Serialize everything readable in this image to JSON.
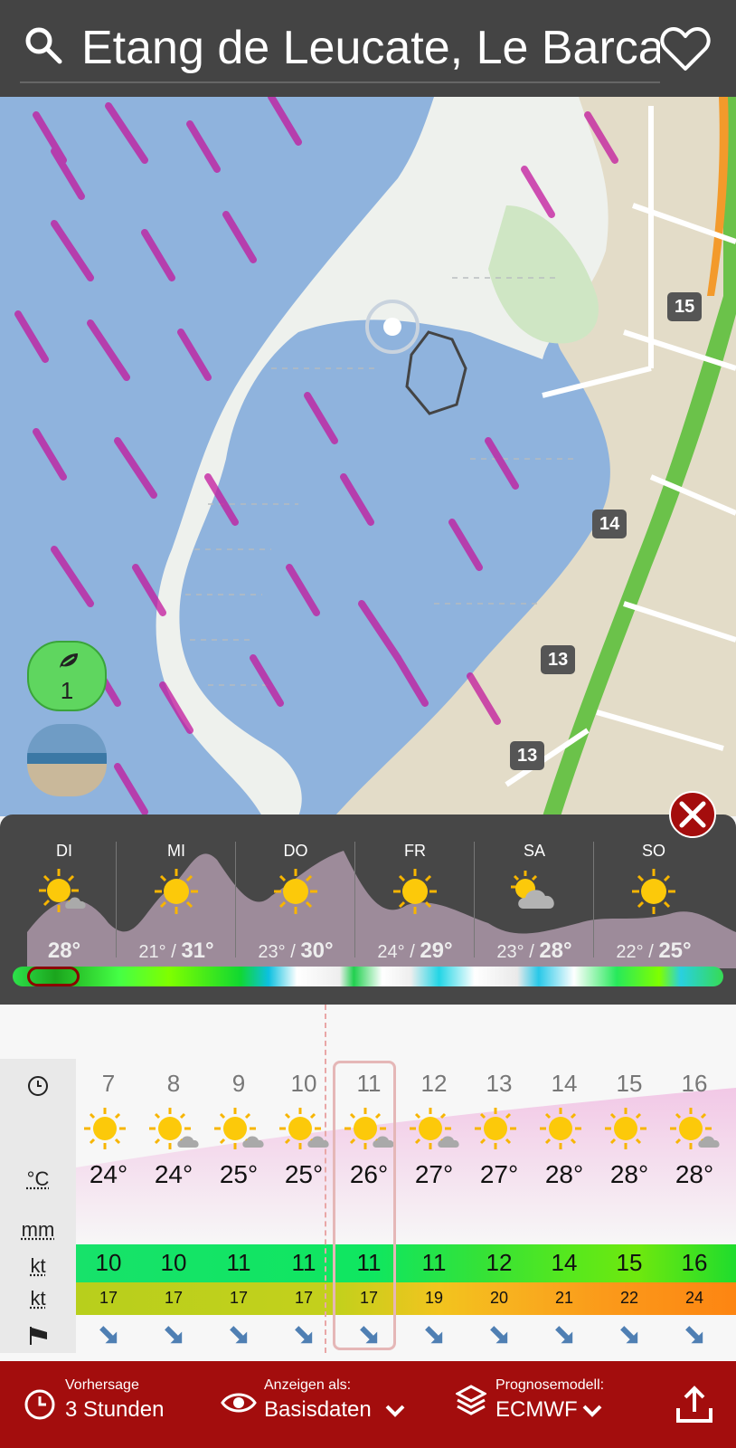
{
  "header": {
    "title": "Etang de Leucate, Le Barcarès"
  },
  "map": {
    "road_labels": [
      "15",
      "14",
      "13",
      "13"
    ],
    "eco_badge": {
      "count": "1"
    }
  },
  "daily": {
    "days": [
      {
        "label": "DI",
        "min": "",
        "max": "28°",
        "icon": "sun-cloud-icon"
      },
      {
        "label": "MI",
        "min": "21°",
        "max": "31°",
        "icon": "sun-icon"
      },
      {
        "label": "DO",
        "min": "23°",
        "max": "30°",
        "icon": "sun-icon"
      },
      {
        "label": "FR",
        "min": "24°",
        "max": "29°",
        "icon": "sun-icon"
      },
      {
        "label": "SA",
        "min": "23°",
        "max": "28°",
        "icon": "cloud-sun-icon"
      },
      {
        "label": "SO",
        "min": "22°",
        "max": "25°",
        "icon": "sun-icon"
      }
    ]
  },
  "hourly": {
    "row_labels": {
      "temp": "°C",
      "rain": "mm",
      "wind": "kt",
      "gust": "kt"
    },
    "hours": [
      {
        "hour": "7",
        "temp": "24°",
        "wind": "10",
        "gust": "17",
        "icon": "sun-icon"
      },
      {
        "hour": "8",
        "temp": "24°",
        "wind": "10",
        "gust": "17",
        "icon": "sun-cloud-icon"
      },
      {
        "hour": "9",
        "temp": "25°",
        "wind": "11",
        "gust": "17",
        "icon": "sun-cloud-icon"
      },
      {
        "hour": "10",
        "temp": "25°",
        "wind": "11",
        "gust": "17",
        "icon": "sun-cloud-icon"
      },
      {
        "hour": "11",
        "temp": "26°",
        "wind": "11",
        "gust": "17",
        "icon": "sun-cloud-icon"
      },
      {
        "hour": "12",
        "temp": "27°",
        "wind": "11",
        "gust": "19",
        "icon": "sun-cloud-icon"
      },
      {
        "hour": "13",
        "temp": "27°",
        "wind": "12",
        "gust": "20",
        "icon": "sun-icon"
      },
      {
        "hour": "14",
        "temp": "28°",
        "wind": "14",
        "gust": "21",
        "icon": "sun-icon"
      },
      {
        "hour": "15",
        "temp": "28°",
        "wind": "15",
        "gust": "22",
        "icon": "sun-icon"
      },
      {
        "hour": "16",
        "temp": "28°",
        "wind": "16",
        "gust": "24",
        "icon": "sun-cloud-icon"
      }
    ],
    "selected_hour": "11"
  },
  "bottom_bar": {
    "forecast_label": "Vorhersage",
    "forecast_value": "3 Stunden",
    "display_label": "Anzeigen als:",
    "display_value": "Basisdaten",
    "model_label": "Prognosemodell:",
    "model_value": "ECMWF"
  },
  "colors": {
    "header_bg": "#444444",
    "accent_red": "#a30d0d",
    "water": "#8fb3dd",
    "wind_streak": "#c2189d"
  }
}
